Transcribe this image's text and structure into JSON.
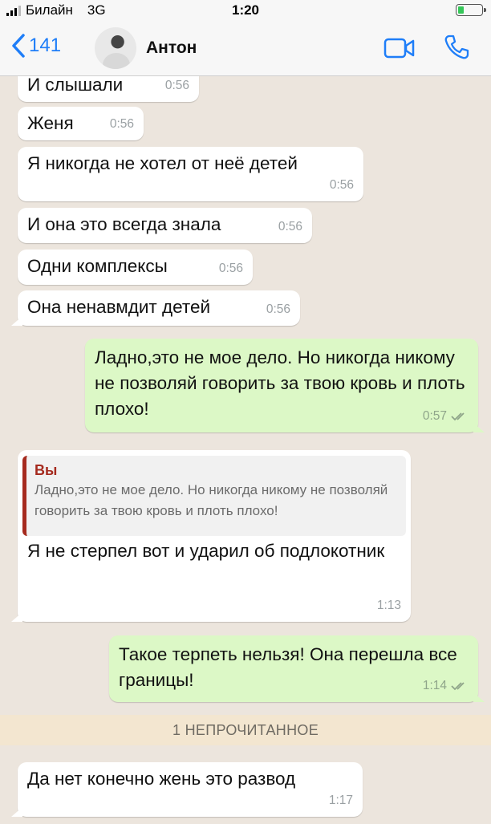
{
  "status": {
    "carrier": "Билайн",
    "network": "3G",
    "time": "1:20",
    "battery_level": 0.25
  },
  "header": {
    "back_count": "141",
    "contact_name": "Антон",
    "icons": [
      "video-call-icon",
      "phone-call-icon"
    ],
    "accent_color": "#1f7ef8"
  },
  "messages": [
    {
      "dir": "in",
      "text": "И слышали",
      "time": "0:56"
    },
    {
      "dir": "in",
      "text": "Женя",
      "time": "0:56"
    },
    {
      "dir": "in",
      "text": "Я никогда не хотел от неё детей",
      "time": "0:56"
    },
    {
      "dir": "in",
      "text": "И она это всегда знала",
      "time": "0:56"
    },
    {
      "dir": "in",
      "text": "Одни комплексы",
      "time": "0:56"
    },
    {
      "dir": "in",
      "text": "Она ненавмдит детей",
      "time": "0:56"
    },
    {
      "dir": "out",
      "text": "Ладно,это не мое дело. Но никогда никому не позволяй говорить за твою кровь и плоть плохо!",
      "time": "0:57",
      "status": "read"
    },
    {
      "dir": "in",
      "quote_author": "Вы",
      "quote_text": "Ладно,это не мое дело. Но никогда никому не позволяй говорить за твою кровь и плоть плохо!",
      "text": "Я не стерпел вот и ударил об подлокотник",
      "time": "1:13"
    },
    {
      "dir": "out",
      "text": "Такое терпеть нельзя! Она перешла все границы!",
      "time": "1:14",
      "status": "read"
    },
    {
      "dir": "in",
      "text": "Да нет конечно жень это развод",
      "time": "1:17"
    }
  ],
  "unread_banner": "1 НЕПРОЧИТАННОЕ",
  "colors": {
    "incoming_bubble": "#ffffff",
    "outgoing_bubble": "#dcf8c6",
    "chat_background": "#ece5dd",
    "quote_accent": "#a52a1e"
  }
}
